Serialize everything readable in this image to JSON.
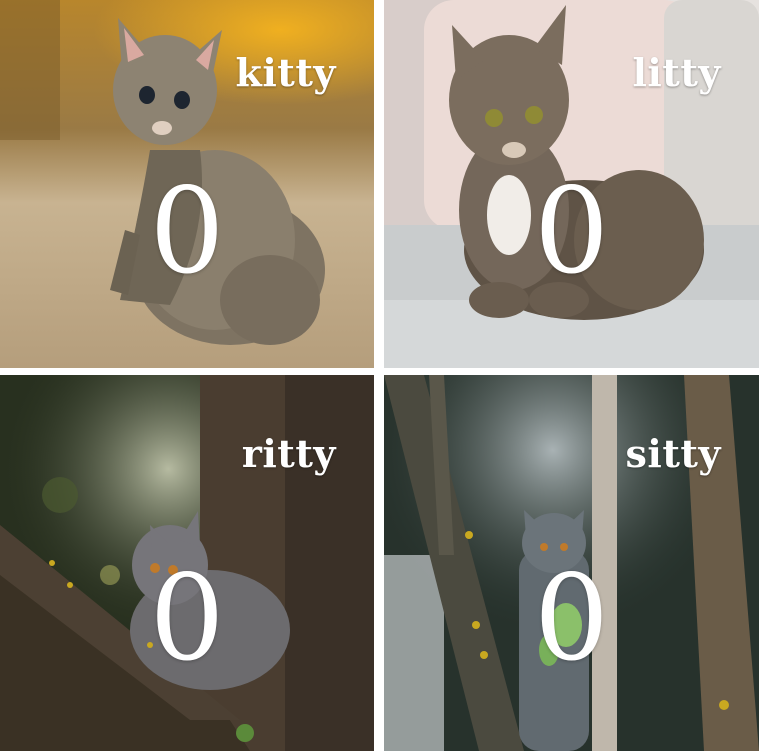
{
  "tiles": [
    {
      "name": "kitty",
      "count": "0",
      "photo": "kitten-on-carpet"
    },
    {
      "name": "litty",
      "count": "0",
      "photo": "tabby-cat-on-sofa"
    },
    {
      "name": "ritty",
      "count": "0",
      "photo": "gray-cat-on-tree-branch"
    },
    {
      "name": "sitty",
      "count": "0",
      "photo": "gray-cat-between-trees"
    }
  ]
}
